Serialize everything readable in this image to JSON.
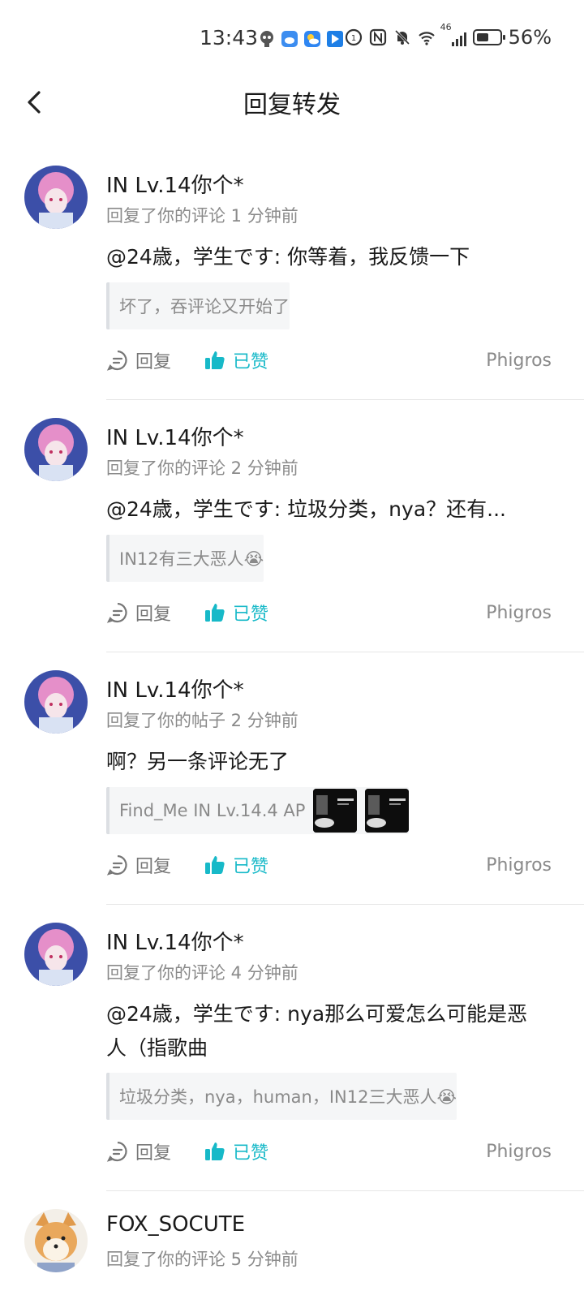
{
  "status_bar": {
    "time": "13:43",
    "network": "46",
    "battery_percent": "56%",
    "battery_level": 0.56
  },
  "header": {
    "title": "回复转发"
  },
  "colors": {
    "accent": "#17b9c8",
    "meta_gray": "#8a8a8a"
  },
  "items": [
    {
      "username": "IN Lv.14你个*",
      "meta": "回复了你的评论 1 分钟前",
      "content": "@24歳，学生です: 你等着，我反馈一下",
      "quote": "坏了，吞评论又开始了",
      "quote_emoji": "",
      "reply_label": "回复",
      "like_label": "已赞",
      "source": "Phigros"
    },
    {
      "username": "IN Lv.14你个*",
      "meta": "回复了你的评论 2 分钟前",
      "content": "@24歳，学生です: 垃圾分类，nya？还有...",
      "quote": "IN12有三大恶人",
      "quote_emoji": "😭",
      "reply_label": "回复",
      "like_label": "已赞",
      "source": "Phigros"
    },
    {
      "username": "IN Lv.14你个*",
      "meta": "回复了你的帖子 2 分钟前",
      "content": "啊？另一条评论无了",
      "quote": "Find_Me IN Lv.14.4 AP",
      "quote_emoji": "",
      "reply_label": "回复",
      "like_label": "已赞",
      "source": "Phigros"
    },
    {
      "username": "IN Lv.14你个*",
      "meta": "回复了你的评论 4 分钟前",
      "content": "@24歳，学生です: nya那么可爱怎么可能是恶人（指歌曲",
      "quote": "垃圾分类，nya，human，IN12三大恶人",
      "quote_emoji": "😭",
      "reply_label": "回复",
      "like_label": "已赞",
      "source": "Phigros"
    },
    {
      "username": "FOX_SOCUTE",
      "meta": "回复了你的评论 5 分钟前"
    }
  ]
}
